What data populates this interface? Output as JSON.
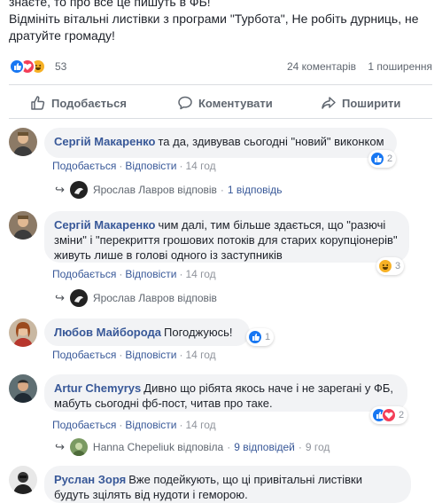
{
  "post": {
    "lines": [
      "знаєте, то про все це пишуть в ФБ!",
      "Відмініть вітальні листівки з програми \"Турбота\", Не робіть дурниць, не",
      "дратуйте громаду!"
    ]
  },
  "stats": {
    "reaction_count": "53",
    "comments": "24 коментарів",
    "shares": "1 поширення"
  },
  "actions": {
    "like": "Подобається",
    "comment": "Коментувати",
    "share": "Поширити"
  },
  "colors": {
    "link": "#385898",
    "bubble": "#f2f3f5",
    "like": "#1877f2",
    "love": "#f33e58",
    "haha": "#f7b125"
  },
  "comments": [
    {
      "author": "Сергій Макаренко",
      "text_lines": [
        "та да, здивував сьогодні \"новий\" виконком"
      ],
      "like": "Подобається",
      "reply": "Відповісти",
      "time": "14 год",
      "reactions": "2",
      "reply_author": "Ярослав Лавров відповів",
      "reply_count": "1 відповідь",
      "reply_time": ""
    },
    {
      "author": "Сергій Макаренко",
      "text_lines": [
        "чим далі, тим більше здається, що \"разючі",
        "зміни\" і \"перекриття грошових потоків для старих корупціонерів\"",
        "живуть лише в голові одного із заступників"
      ],
      "like": "Подобається",
      "reply": "Відповісти",
      "time": "14 год",
      "reactions": "3",
      "reply_author": "Ярослав Лавров відповів",
      "reply_count": "",
      "reply_time": ""
    },
    {
      "author": "Любов Майборода",
      "text_lines": [
        "Погоджуюсь!"
      ],
      "like": "Подобається",
      "reply": "Відповісти",
      "time": "14 год",
      "reactions": "1",
      "reply_author": "",
      "reply_count": "",
      "reply_time": ""
    },
    {
      "author": "Artur Chemyrys",
      "text_lines": [
        "Дивно що рібята якось наче і не зарегані у ФБ,",
        "мабуть сьогодні фб-пост, читав про таке."
      ],
      "like": "Подобається",
      "reply": "Відповісти",
      "time": "14 год",
      "reactions": "2",
      "reply_author": "Hanna Chepeliuk відповіла",
      "reply_count": "9 відповідей",
      "reply_time": "9 год"
    },
    {
      "author": "Руслан Зоря",
      "text_lines": [
        "Вже подейкують, що ці привітальні листівки",
        "будуть зцілять від нудоти і геморою."
      ],
      "like": "",
      "reply": "",
      "time": "",
      "reactions": "",
      "reply_author": "",
      "reply_count": "",
      "reply_time": ""
    }
  ]
}
